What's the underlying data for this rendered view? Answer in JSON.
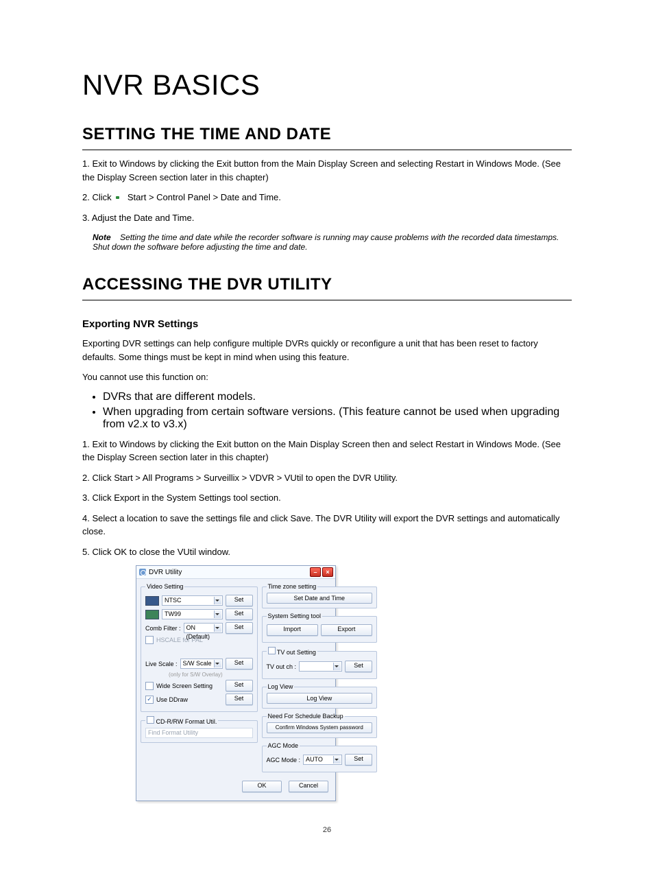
{
  "page": {
    "title": "NVR BASICS",
    "h2_a": "SETTING THE TIME AND DATE",
    "h2_b": "ACCESSING THE DVR UTILITY",
    "h3_b1": "Exporting NVR Settings",
    "p1": "1.  Exit to Windows by clicking the Exit button from the Main Display Screen and selecting Restart in Windows Mode. (See the Display Screen section later in this chapter)",
    "p2_a": "2.  Click",
    "p2_b": "  Start > Control Panel > Date and Time.",
    "p3_a": "3.  Adjust the Date and Time.",
    "note_label": "Note",
    "note_text": "Setting the time and date while the recorder software is running may cause problems with the recorded data timestamps. Shut down the software before adjusting the time and date.",
    "sec2_p1": "Exporting DVR settings can help configure multiple DVRs quickly or reconfigure a unit that has been reset to factory defaults. Some things must be kept in mind when using this feature.",
    "sec2_p2": "You cannot use this function on:",
    "bul1": "DVRs that are different models.",
    "bul2": "When upgrading from certain software versions. (This feature cannot be used when upgrading from v2.x to v3.x)",
    "ol1": "1.  Exit to Windows by clicking the Exit button on the Main Display Screen then and select Restart in Windows Mode. (See the Display Screen section later in this chapter)",
    "ol2": "2.  Click Start > All Programs > Surveillix > VDVR > VUtil to open the DVR Utility.",
    "ol3": "3.  Click Export in the System Settings tool section.",
    "ol4": "4.  Select a location to save the settings file and click Save. The DVR Utility will export the DVR settings and automatically close.",
    "ol5": "5.  Click OK to close the VUtil window.",
    "pgnum": "26"
  },
  "win": {
    "title": "DVR Utility",
    "video_setting_legend": "Video Setting",
    "ntsc": "NTSC",
    "tw99": "TW99",
    "comb_filter_lbl": "Comb Filter :",
    "comb_filter_val": "ON (Default)",
    "hscale_pal": "HSCALE for PAL",
    "livescale_lbl": "Live Scale :",
    "livescale_val": "S/W Scale",
    "livescale_hint": "(only for S/W Overlay)",
    "wide_screen": "Wide Screen Setting",
    "use_ddraw": "Use DDraw",
    "cd_format_legend": "CD-R/RW Format Util.",
    "find_format": "Find Format Utility",
    "set": "Set",
    "tz_legend": "Time zone setting",
    "tz_btn": "Set Date and Time",
    "sys_tool_legend": "System Setting tool",
    "import": "Import",
    "export": "Export",
    "tvout_legend": "TV out Setting",
    "tvout_lbl": "TV out ch :",
    "logview_legend": "Log View",
    "logview_btn": "Log View",
    "sched_legend": "Need For Schedule Backup",
    "sched_btn": "Confirm Windows System password",
    "agc_legend": "AGC Mode",
    "agc_lbl": "AGC Mode :",
    "agc_val": "AUTO",
    "ok": "OK",
    "cancel": "Cancel"
  }
}
